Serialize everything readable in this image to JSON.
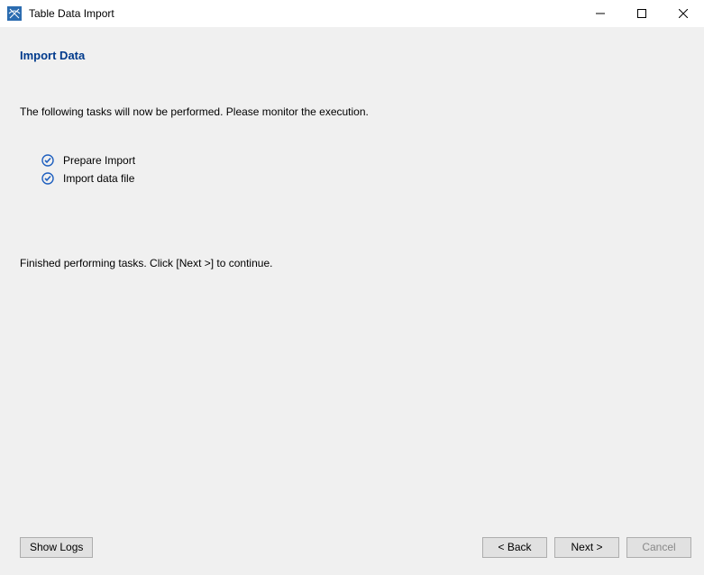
{
  "titlebar": {
    "title": "Table Data Import"
  },
  "main": {
    "heading": "Import Data",
    "instruction": "The following tasks will now be performed. Please monitor the execution.",
    "tasks": [
      {
        "label": "Prepare Import"
      },
      {
        "label": "Import data file"
      }
    ],
    "status": "Finished performing tasks. Click [Next >] to continue."
  },
  "footer": {
    "show_logs": "Show Logs",
    "back": "< Back",
    "next": "Next >",
    "cancel": "Cancel"
  }
}
